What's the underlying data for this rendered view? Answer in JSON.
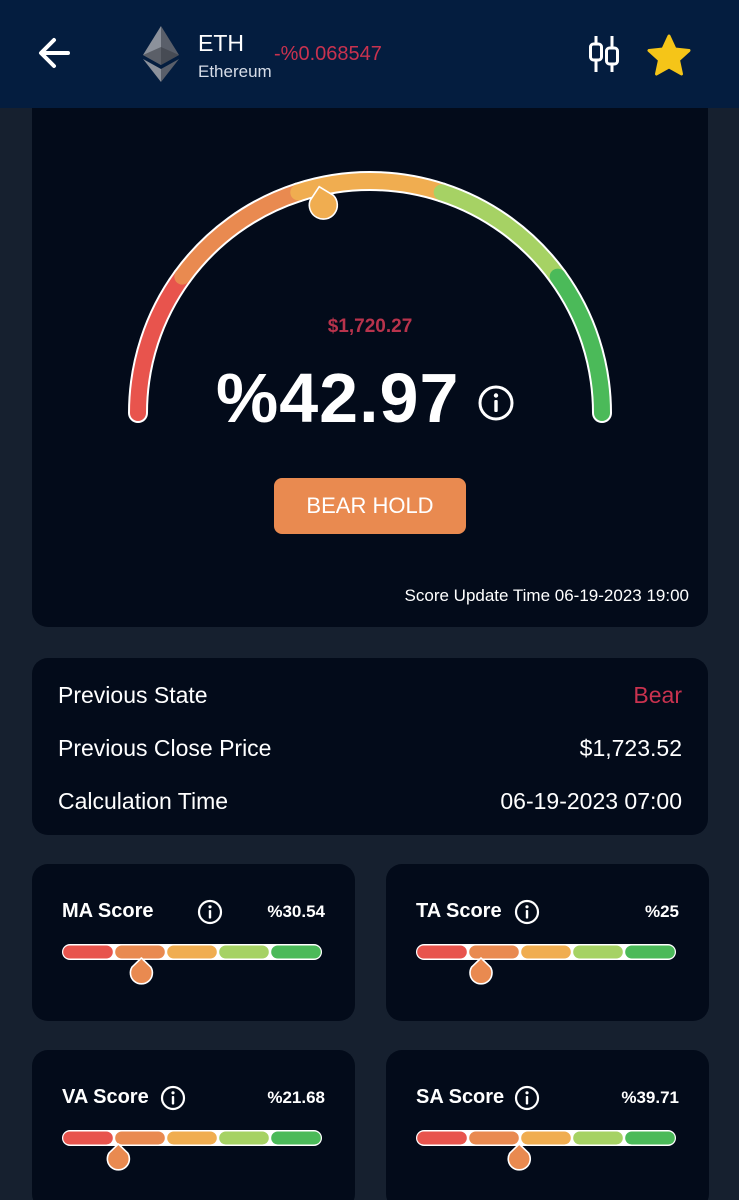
{
  "header": {
    "symbol": "ETH",
    "name": "Ethereum",
    "change": "-%0.068547",
    "icons": [
      "back-arrow-icon",
      "ethereum-logo-icon",
      "candlestick-chart-icon",
      "star-icon"
    ],
    "colors": {
      "background": "#041d3f",
      "change": "#c9324f",
      "star": "#f5c518"
    }
  },
  "gauge": {
    "price": "$1,720.27",
    "score": "%42.97",
    "score_value": 42.97,
    "state": "BEAR HOLD",
    "update_time": "Score Update Time 06-19-2023 19:00",
    "colors": [
      "#e8544d",
      "#e98a50",
      "#f0ad50",
      "#a6d264",
      "#4bba59"
    ]
  },
  "previous": {
    "rows": [
      {
        "label": "Previous State",
        "value": "Bear"
      },
      {
        "label": "Previous Close Price",
        "value": "$1,723.52"
      },
      {
        "label": "Calculation Time",
        "value": "06-19-2023 07:00"
      }
    ]
  },
  "scores": [
    {
      "title": "MA Score",
      "pct": "%30.54",
      "value": 30.54
    },
    {
      "title": "TA Score",
      "pct": "%25",
      "value": 25
    },
    {
      "title": "VA Score",
      "pct": "%21.68",
      "value": 21.68
    },
    {
      "title": "SA Score",
      "pct": "%39.71",
      "value": 39.71
    }
  ]
}
